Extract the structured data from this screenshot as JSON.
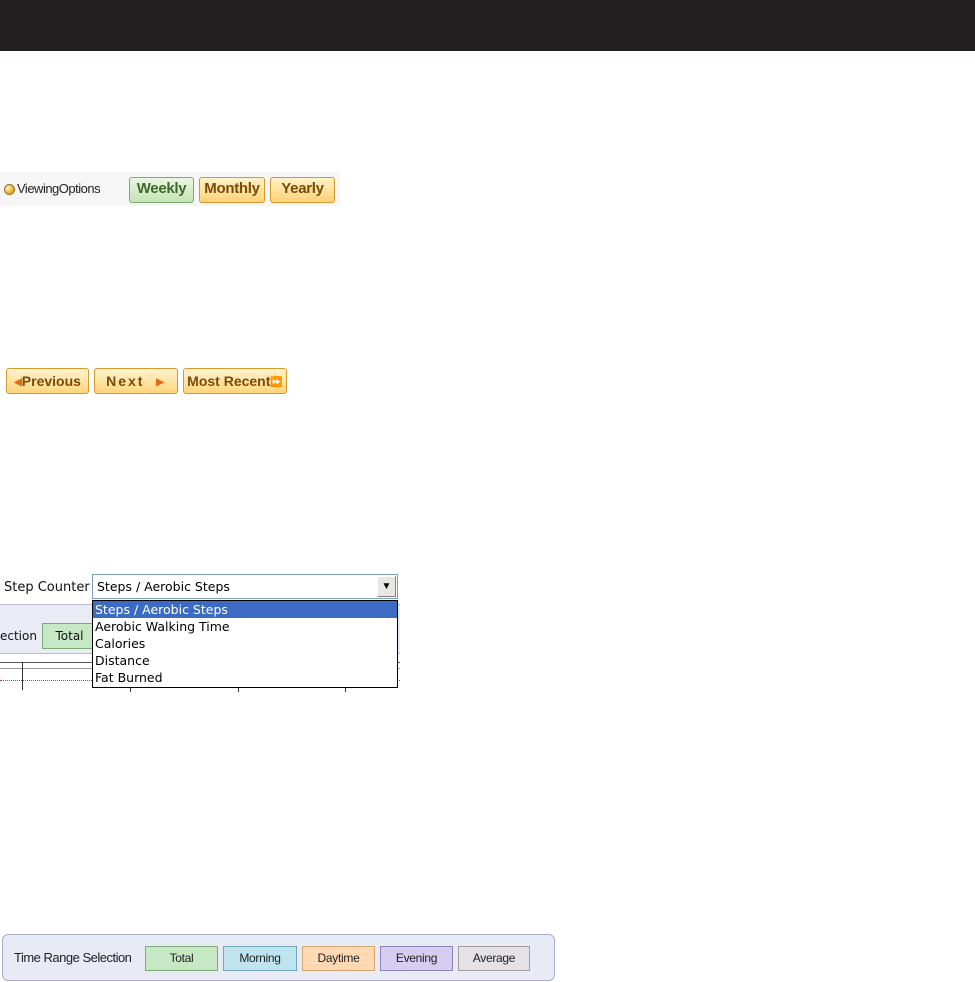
{
  "viewing_options": {
    "label": "ViewingOptions",
    "weekly": "Weekly",
    "monthly": "Monthly",
    "yearly": "Yearly"
  },
  "navigation": {
    "previous": "Previous",
    "next": "Next",
    "most_recent": "Most Recent"
  },
  "step_counter": {
    "label": "Step Counter",
    "selected": "Steps / Aerobic Steps",
    "options": [
      "Steps / Aerobic Steps",
      "Aerobic Walking Time",
      "Calories",
      "Distance",
      "Fat Burned"
    ],
    "behind_label": "ection",
    "behind_total": "Total"
  },
  "time_range": {
    "label": "Time Range Selection",
    "total": "Total",
    "morning": "Morning",
    "daytime": "Daytime",
    "evening": "Evening",
    "average": "Average"
  },
  "colors": {
    "top_bar": "#231f20",
    "selected_option": "#3d6bc4",
    "orange_button": "#ffd57c",
    "green_button": "#c7e8c4"
  }
}
